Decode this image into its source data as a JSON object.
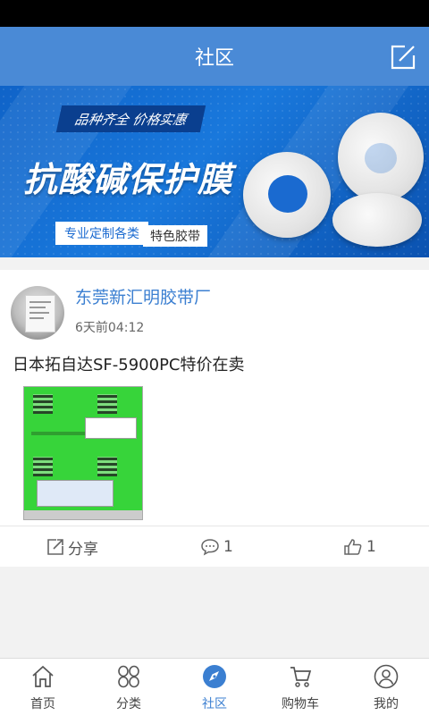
{
  "header": {
    "title": "社区",
    "compose_icon": "edit-icon"
  },
  "banner": {
    "subtitle": "品种齐全 价格实惠",
    "title": "抗酸碱保护膜",
    "tag1": "专业定制各类",
    "tag2": "特色胶带"
  },
  "post": {
    "author": "东莞新汇明胶带厂",
    "time": "6天前04:12",
    "text": "日本拓自达SF-5900PC特价在卖",
    "actions": {
      "share_label": "分享",
      "comment_count": "1",
      "like_count": "1"
    }
  },
  "tabs": [
    {
      "label": "首页",
      "icon": "home-icon"
    },
    {
      "label": "分类",
      "icon": "category-icon"
    },
    {
      "label": "社区",
      "icon": "compass-icon",
      "active": true
    },
    {
      "label": "购物车",
      "icon": "cart-icon"
    },
    {
      "label": "我的",
      "icon": "profile-icon"
    }
  ],
  "colors": {
    "accent": "#4a8ad6",
    "link": "#3b7fd1"
  }
}
